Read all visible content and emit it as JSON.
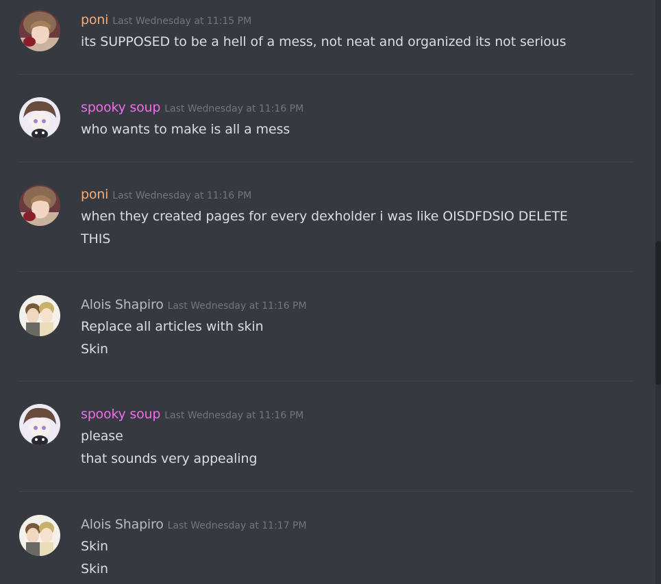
{
  "colors": {
    "background": "#36393f",
    "poni": "#f5ad7a",
    "spooky_soup": "#f06ee8",
    "alois": "#b9bbbe",
    "timestamp": "#72767d",
    "text": "#dcddde"
  },
  "messages": [
    {
      "author": "poni",
      "avatar_icon": "poni-avatar-icon",
      "timestamp": "Last Wednesday at 11:15 PM",
      "lines": [
        "its SUPPOSED to be a hell of a mess, not neat and organized its not serious"
      ]
    },
    {
      "author": "spooky soup",
      "avatar_icon": "spooky-soup-avatar-icon",
      "timestamp": "Last Wednesday at 11:16 PM",
      "lines": [
        "who wants to make is all a mess"
      ]
    },
    {
      "author": "poni",
      "avatar_icon": "poni-avatar-icon",
      "timestamp": "Last Wednesday at 11:16 PM",
      "lines": [
        "when they created pages for every dexholder i was like OISDFDSIO DELETE",
        "THIS"
      ]
    },
    {
      "author": "Alois Shapiro",
      "avatar_icon": "alois-avatar-icon",
      "timestamp": "Last Wednesday at 11:16 PM",
      "lines": [
        "Replace all articles with skin",
        "Skin"
      ]
    },
    {
      "author": "spooky soup",
      "avatar_icon": "spooky-soup-avatar-icon",
      "timestamp": "Last Wednesday at 11:16 PM",
      "lines": [
        "please",
        "that sounds very appealing"
      ]
    },
    {
      "author": "Alois Shapiro",
      "avatar_icon": "alois-avatar-icon",
      "timestamp": "Last Wednesday at 11:17 PM",
      "lines": [
        "Skin",
        "Skin"
      ]
    }
  ]
}
